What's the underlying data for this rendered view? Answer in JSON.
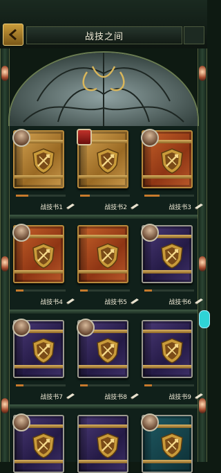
{
  "header": {
    "title": "战技之间"
  },
  "books": [
    {
      "name": "战技书1",
      "color": "gold",
      "badge": "portrait",
      "progress": 0.25
    },
    {
      "name": "战技书2",
      "color": "gold",
      "badge": "red-shield",
      "progress": 0.2
    },
    {
      "name": "战技书3",
      "color": "red",
      "badge": "portrait",
      "progress": 0.3
    },
    {
      "name": "战技书4",
      "color": "red",
      "badge": "portrait",
      "progress": 0.15
    },
    {
      "name": "战技书5",
      "color": "red",
      "badge": "none",
      "progress": 0.15
    },
    {
      "name": "战技书6",
      "color": "purple",
      "badge": "portrait",
      "progress": 0.15
    },
    {
      "name": "战技书7",
      "color": "purple",
      "badge": "portrait",
      "progress": 0.15
    },
    {
      "name": "战技书8",
      "color": "purple",
      "badge": "portrait",
      "progress": 0.15
    },
    {
      "name": "战技书9",
      "color": "purple",
      "badge": "none",
      "progress": 0.15
    }
  ],
  "partial_row": [
    {
      "color": "purple",
      "badge": "portrait"
    },
    {
      "color": "purple",
      "badge": "none"
    },
    {
      "color": "teal",
      "badge": "portrait"
    }
  ],
  "colors": {
    "accent_gold": "#c99b3a",
    "progress": "#c77a2c",
    "background": "#0e1a12"
  },
  "icons": {
    "back": "back-arrow-icon",
    "scroll": "scroll-icon"
  }
}
